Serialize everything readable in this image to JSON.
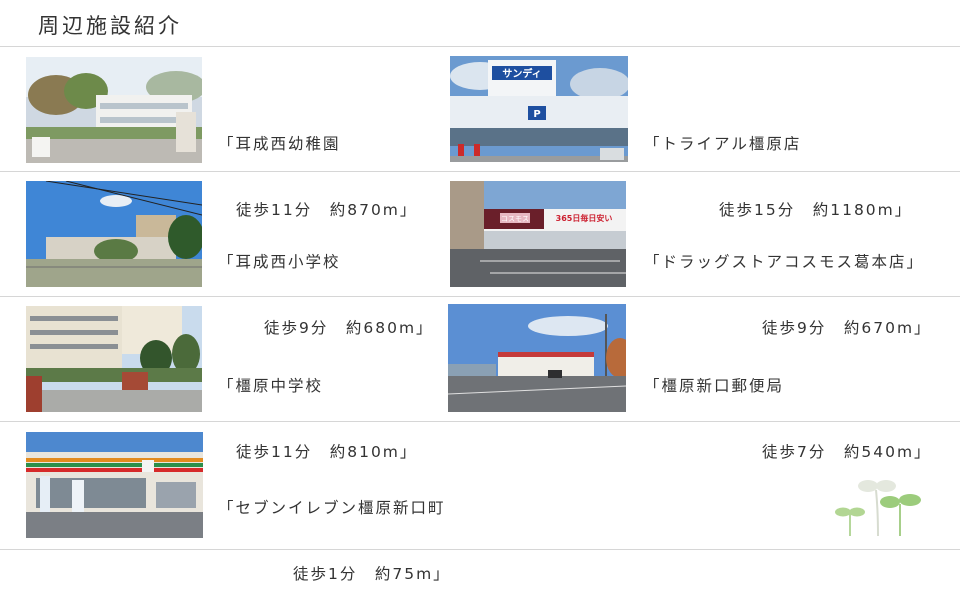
{
  "page_title": "周辺施設紹介",
  "facilities": [
    {
      "name": "「耳成西幼稚園",
      "distance": "徒歩11分　約870m」"
    },
    {
      "name": "「トライアル橿原店",
      "distance": "徒歩15分　約1180m」"
    },
    {
      "name": "「耳成西小学校",
      "distance": "徒歩9分　約680m」"
    },
    {
      "name": "「ドラッグストアコスモス葛本店」",
      "distance": "徒歩9分　約670m」"
    },
    {
      "name": "「橿原中学校",
      "distance": "徒歩11分　約810m」"
    },
    {
      "name": "「橿原新口郵便局",
      "distance": "徒歩7分　約540m」"
    },
    {
      "name": "「セブンイレブン橿原新口町",
      "distance": "徒歩1分　約75m」"
    }
  ],
  "sign_text": {
    "trial_sign": "サンディ",
    "trial_p": "P",
    "cosmos_sign": "コスモス",
    "cosmos_banner": "365日毎日安い"
  }
}
